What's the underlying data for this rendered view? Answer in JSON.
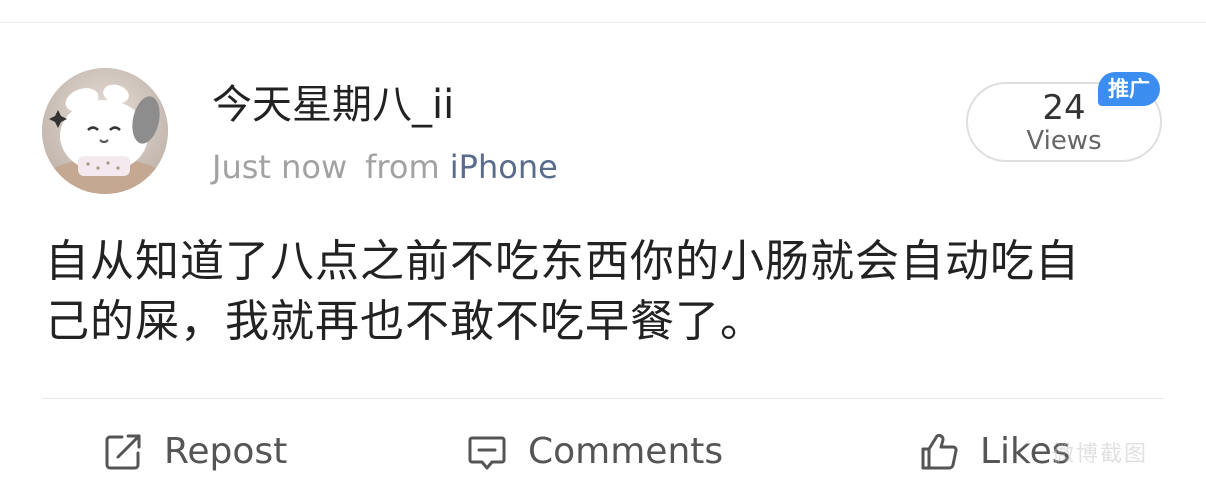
{
  "post": {
    "author": {
      "username": "今天星期八_ii",
      "avatar_icon": "plush-bunny-avatar"
    },
    "meta": {
      "time": "Just now",
      "from_label": "from",
      "device": "iPhone"
    },
    "views": {
      "count": "24",
      "label": "Views"
    },
    "promo_badge": "推广",
    "body_lines": [
      "自从知道了八点之前不吃东西你的小肠就会自动吃自",
      "己的屎，我就再也不敢不吃早餐了。"
    ]
  },
  "actions": {
    "repost": {
      "label": "Repost",
      "icon": "repost-icon"
    },
    "comments": {
      "label": "Comments",
      "icon": "comment-icon"
    },
    "likes": {
      "label": "Likes",
      "icon": "thumbs-up-icon"
    }
  },
  "watermark": "微博截图",
  "colors": {
    "device_link": "#5a6c8c",
    "meta_gray": "#a2a2a2",
    "badge_blue": "#3b8ef0",
    "action_gray": "#555555"
  }
}
